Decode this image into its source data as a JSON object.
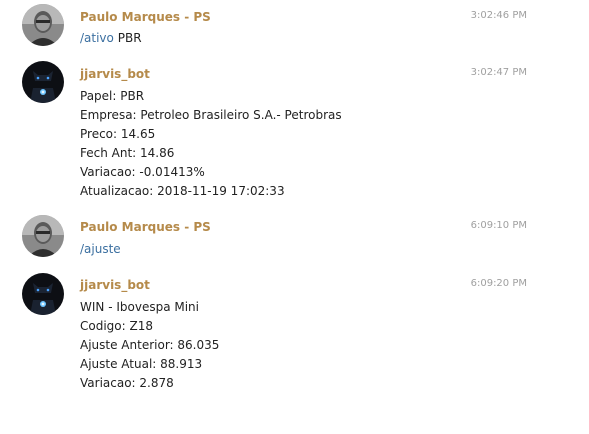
{
  "messages": [
    {
      "sender": "Paulo Marques - PS",
      "time": "3:02:46 PM",
      "avatar": "user-photo-avatar",
      "command": "/ativo",
      "command_arg": "PBR"
    },
    {
      "sender": "jjarvis_bot",
      "time": "3:02:47 PM",
      "avatar": "bot-avatar",
      "lines": [
        "Papel: PBR",
        "Empresa: Petroleo Brasileiro S.A.- Petrobras",
        "Preco: 14.65",
        "Fech Ant: 14.86",
        "Variacao: -0.01413%",
        "Atualizacao: 2018-11-19 17:02:33"
      ]
    },
    {
      "sender": "Paulo Marques - PS",
      "time": "6:09:10 PM",
      "avatar": "user-photo-avatar",
      "command": "/ajuste",
      "command_arg": ""
    },
    {
      "sender": "jjarvis_bot",
      "time": "6:09:20 PM",
      "avatar": "bot-avatar",
      "lines": [
        "WIN - Ibovespa Mini",
        "Codigo: Z18",
        "Ajuste Anterior: 86.035",
        "Ajuste Atual: 88.913",
        "Variacao: 2.878"
      ]
    }
  ],
  "colors": {
    "sender": "#b58a4a",
    "time": "#a0a0a0",
    "text": "#222222",
    "command": "#3b6fa0"
  }
}
